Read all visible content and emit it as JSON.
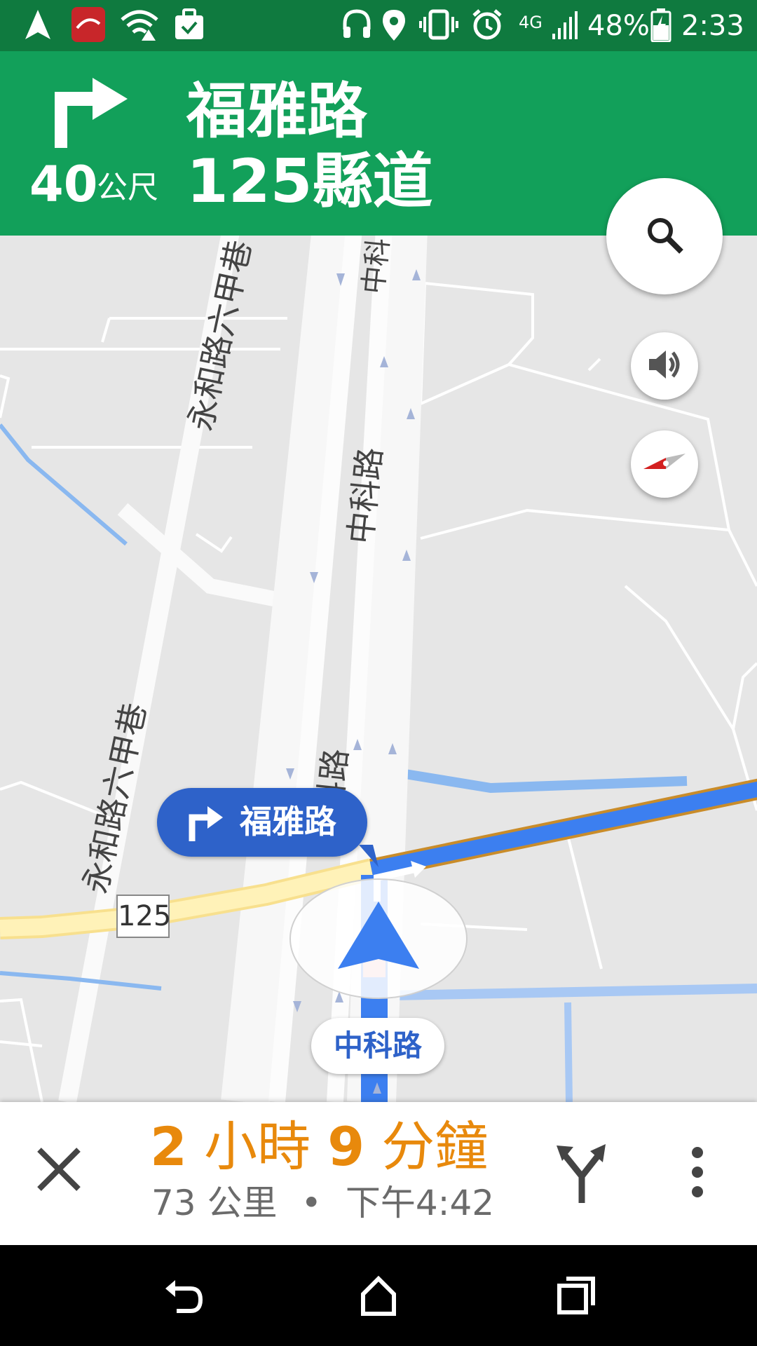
{
  "status_bar": {
    "battery": "48%",
    "time": "2:33",
    "network": "4G"
  },
  "navigation": {
    "distance_value": "40",
    "distance_unit": "公尺",
    "street_primary": "福雅路",
    "street_secondary": "125縣道",
    "maneuver": "turn-right"
  },
  "map": {
    "turn_callout": "福雅路",
    "current_road": "中科路",
    "route_shield": "125",
    "street_labels": {
      "yonghe_top": "永和路六甲巷",
      "yonghe_bottom": "永和路六甲巷",
      "zhongke_top": "中科",
      "zhongke_mid": "中科路",
      "zhongke_low": "科路"
    }
  },
  "trip": {
    "duration_hours": "2",
    "duration_hours_unit": "小時",
    "duration_minutes": "9",
    "duration_minutes_unit": "分鐘",
    "distance": "73 公里",
    "separator": "•",
    "arrival": "下午4:42"
  },
  "colors": {
    "header_green": "#12a05a",
    "status_green": "#0f7a3f",
    "route_blue": "#2e62c9",
    "eta_orange": "#e8890c"
  }
}
